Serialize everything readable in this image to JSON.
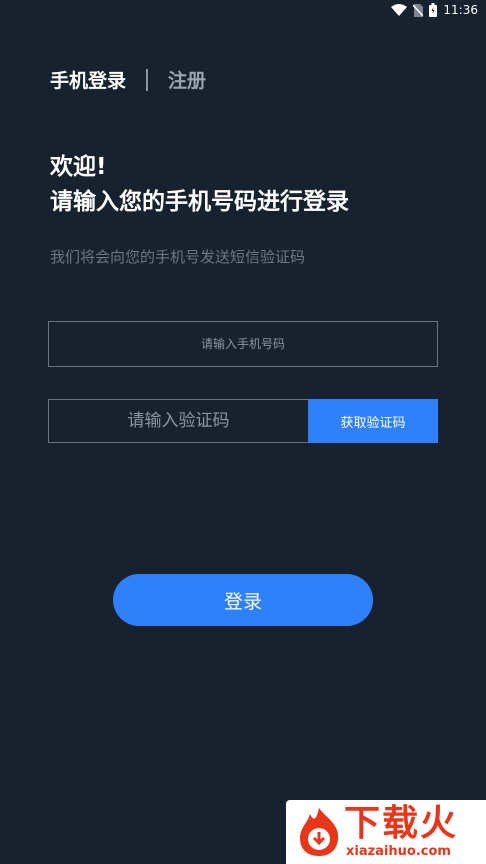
{
  "status_bar": {
    "time": "11:36",
    "icons": [
      "wifi-icon",
      "no-sim-icon",
      "battery-icon"
    ]
  },
  "tabs": {
    "active_label": "手机登录",
    "divider": "|",
    "inactive_label": "注册"
  },
  "welcome": {
    "line1": "欢迎!",
    "line2": "请输入您的手机号码进行登录"
  },
  "subtitle": "我们将会向您的手机号发送短信验证码",
  "phone_input": {
    "placeholder": "请输入手机号码",
    "value": ""
  },
  "code_input": {
    "placeholder": "请输入验证码",
    "value": ""
  },
  "get_code_button": "获取验证码",
  "login_button": "登录",
  "watermark": {
    "brand": "下载火",
    "url": "xiazaihuo.com"
  },
  "colors": {
    "background": "#18212e",
    "accent": "#2f80fb",
    "watermark": "#e8361b"
  }
}
